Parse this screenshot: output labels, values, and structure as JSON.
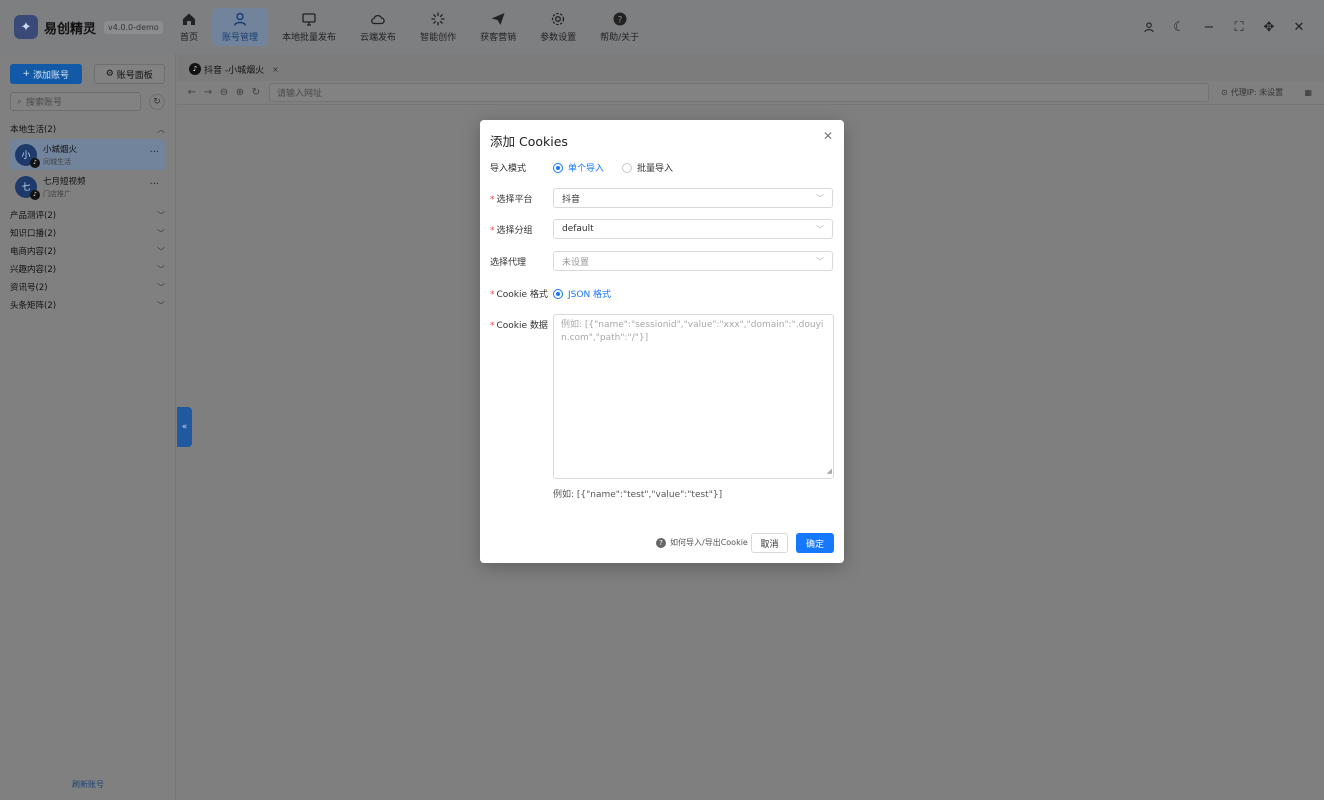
{
  "app": {
    "name": "易创精灵",
    "version": "v4.0.0-demo"
  },
  "nav": [
    {
      "label": "首页",
      "icon": "home-icon"
    },
    {
      "label": "账号管理",
      "icon": "user-icon",
      "active": true
    },
    {
      "label": "本地批量发布",
      "icon": "monitor-icon"
    },
    {
      "label": "云端发布",
      "icon": "cloud-icon"
    },
    {
      "label": "智能创作",
      "icon": "spark-icon"
    },
    {
      "label": "获客营销",
      "icon": "send-icon"
    },
    {
      "label": "参数设置",
      "icon": "gear-icon"
    },
    {
      "label": "帮助/关于",
      "icon": "help-icon"
    }
  ],
  "sidebar": {
    "add_label": "添加账号",
    "panel_label": "账号面板",
    "search_placeholder": "搜索账号",
    "groups": [
      {
        "label": "本地生活(2)",
        "expanded": true,
        "accounts": [
          {
            "avatar": "小",
            "name": "小城烟火",
            "sub": "同城生活",
            "active": true
          },
          {
            "avatar": "七",
            "name": "七月短视频",
            "sub": "门店推广",
            "active": false
          }
        ]
      },
      {
        "label": "产品测评(2)"
      },
      {
        "label": "知识口播(2)"
      },
      {
        "label": "电商内容(2)"
      },
      {
        "label": "兴趣内容(2)"
      },
      {
        "label": "资讯号(2)"
      },
      {
        "label": "头条矩阵(2)"
      }
    ],
    "footer_label": "刷新账号"
  },
  "browser": {
    "tab_label": "抖音 -小城烟火",
    "url_placeholder": "请输入网址",
    "proxy_label": "代理IP: 未设置"
  },
  "modal": {
    "title": "添加 Cookies",
    "import_mode_label": "导入模式",
    "import_modes": [
      "单个导入",
      "批量导入"
    ],
    "platform_label": "选择平台",
    "platform_value": "抖音",
    "group_label": "选择分组",
    "group_value": "default",
    "proxy_label": "选择代理",
    "proxy_value": "未设置",
    "cookie_format_label": "Cookie 格式",
    "cookie_format_value": "JSON 格式",
    "cookie_data_label": "Cookie 数据",
    "cookie_data_placeholder": "例如: [{\"name\":\"sessionid\",\"value\":\"xxx\",\"domain\":\".douyin.com\",\"path\":\"/\"}]",
    "hint": "例如: [{\"name\":\"test\",\"value\":\"test\"}]",
    "help_link": "如何导入/导出Cookie",
    "cancel_label": "取消",
    "confirm_label": "确定"
  },
  "colors": {
    "accent": "#1677ff",
    "required": "#e5484d"
  }
}
